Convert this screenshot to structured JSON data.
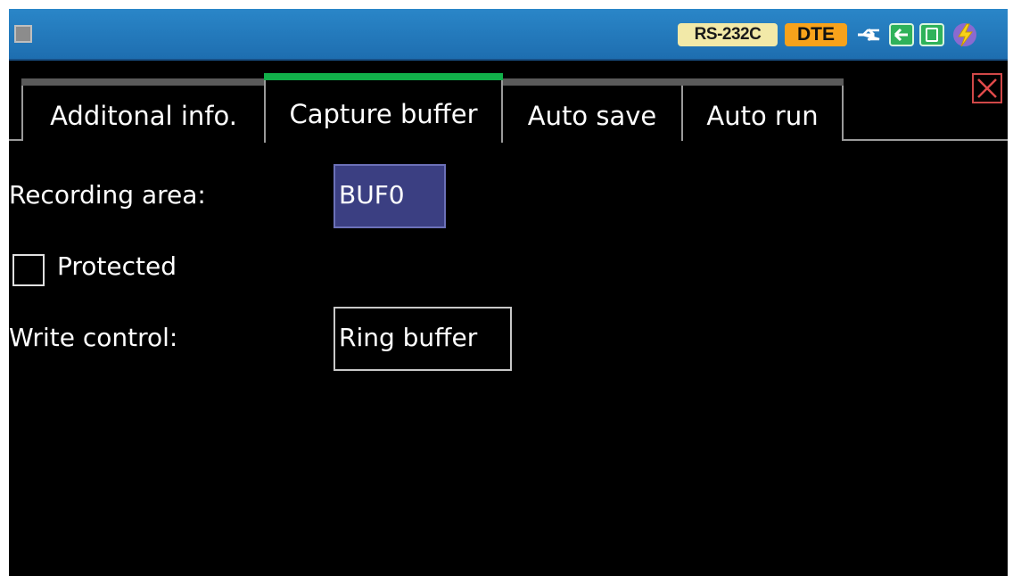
{
  "status_bar": {
    "interface_badge": "RS-232C",
    "mode_badge": "DTE",
    "icons": [
      "menu-icon",
      "usb-icon",
      "card-transfer-icon",
      "sd-card-icon",
      "power-icon"
    ],
    "colors": {
      "bar": "#1e6eb0",
      "interface_badge_bg": "#f2e9a8",
      "mode_badge_bg": "#f7a21b"
    }
  },
  "tabs": [
    {
      "label": "Additonal info.",
      "active": false
    },
    {
      "label": "Capture buffer",
      "active": true
    },
    {
      "label": "Auto save",
      "active": false
    },
    {
      "label": "Auto run",
      "active": false
    }
  ],
  "active_tab_color": "#11b04a",
  "form": {
    "recording_area_label": "Recording area:",
    "recording_area_value": "BUF0",
    "protected_label": "Protected",
    "protected_checked": false,
    "write_control_label": "Write control:",
    "write_control_value": "Ring buffer"
  }
}
